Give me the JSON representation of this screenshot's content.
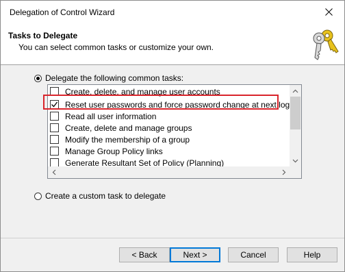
{
  "window": {
    "title": "Delegation of Control Wizard"
  },
  "header": {
    "title": "Tasks to Delegate",
    "subtitle": "You can select common tasks or customize your own.",
    "icon": "keys-icon"
  },
  "options": {
    "common": {
      "label": "Delegate the following common tasks:",
      "selected": true
    },
    "custom": {
      "label": "Create a custom task to delegate",
      "selected": false
    }
  },
  "tasks": [
    {
      "label": "Create, delete, and manage user accounts",
      "checked": false
    },
    {
      "label": "Reset user passwords and force password change at next logon",
      "checked": true
    },
    {
      "label": "Read all user information",
      "checked": false
    },
    {
      "label": "Create, delete and manage groups",
      "checked": false
    },
    {
      "label": "Modify the membership of a group",
      "checked": false
    },
    {
      "label": "Manage Group Policy links",
      "checked": false
    },
    {
      "label": "Generate Resultant Set of Policy (Planning)",
      "checked": false
    }
  ],
  "buttons": {
    "back": "< Back",
    "next": "Next >",
    "cancel": "Cancel",
    "help": "Help"
  },
  "colors": {
    "highlight": "#d9242b",
    "accent": "#0078d7"
  }
}
